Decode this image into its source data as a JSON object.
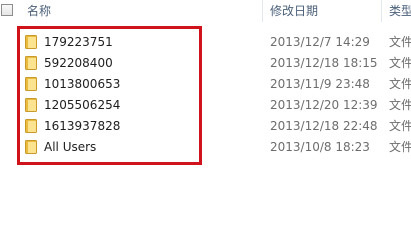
{
  "header": {
    "name_label": "名称",
    "date_label": "修改日期",
    "type_label": "类型"
  },
  "rows": [
    {
      "name": "179223751",
      "modified": "2013/12/7 14:29",
      "type": "文件"
    },
    {
      "name": "592208400",
      "modified": "2013/12/18 18:15",
      "type": "文件"
    },
    {
      "name": "1013800653",
      "modified": "2013/11/9 23:48",
      "type": "文件"
    },
    {
      "name": "1205506254",
      "modified": "2013/12/20 12:39",
      "type": "文件"
    },
    {
      "name": "1613937828",
      "modified": "2013/12/18 22:48",
      "type": "文件"
    },
    {
      "name": "All Users",
      "modified": "2013/10/8 18:23",
      "type": "文件"
    }
  ],
  "colors": {
    "highlight": "#d0121b",
    "folder_body": "#f3cf5e",
    "folder_front": "#fbe38f"
  },
  "icons": {
    "row_icon": "folder-icon"
  }
}
